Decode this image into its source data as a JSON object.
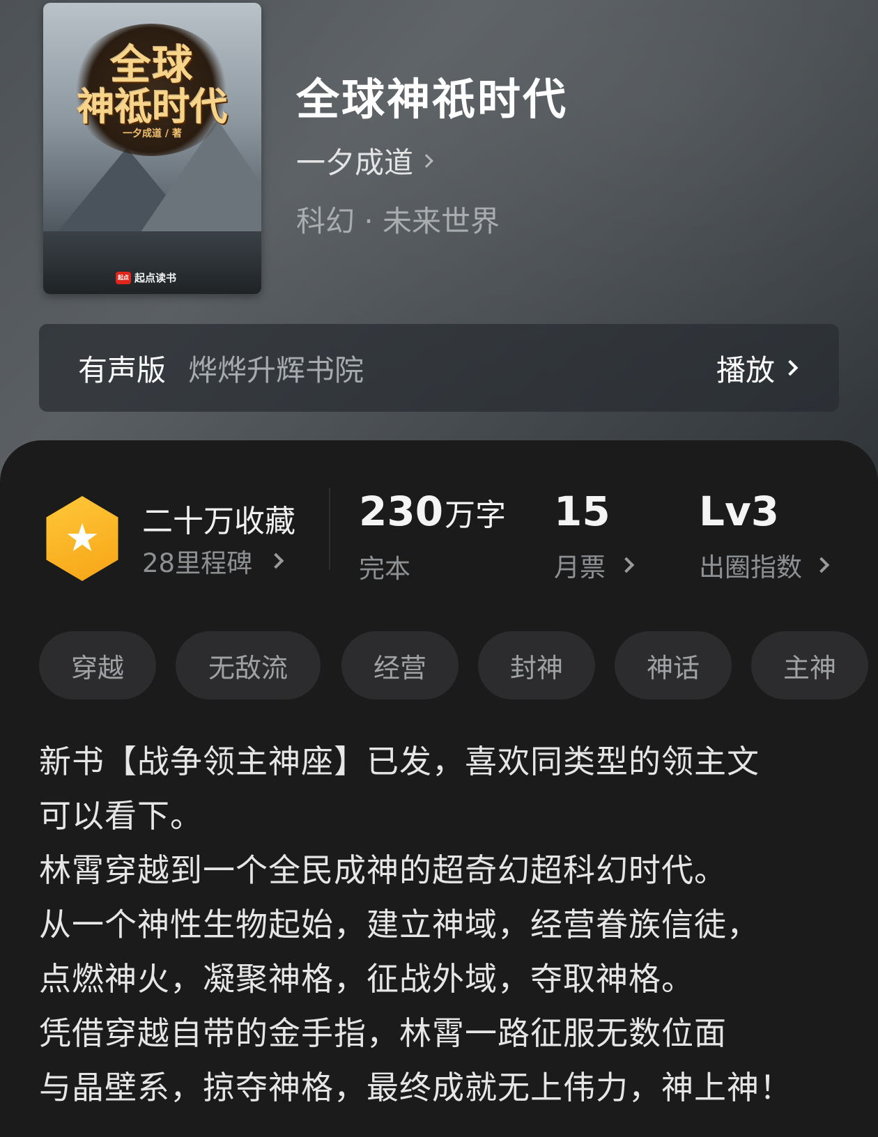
{
  "book": {
    "cover": {
      "title_line1": "全球",
      "title_line2": "神祗时代",
      "byline": "一夕成道 / 著",
      "publisher": "起点读书",
      "publisher_logo": "起点"
    },
    "title": "全球神祇时代",
    "author": "一夕成道",
    "genre": "科幻 · 未来世界"
  },
  "audio": {
    "label": "有声版",
    "narrator": "烨烨升辉书院",
    "play_label": "播放"
  },
  "stats": {
    "favorites": "二十万收藏",
    "milestones": "28里程碑",
    "words_number": "230",
    "words_unit": "万字",
    "status": "完本",
    "monthly_votes": "15",
    "monthly_votes_label": "月票",
    "level": "Lv3",
    "level_label": "出圈指数",
    "badge_color": "#F8B21F"
  },
  "tags": [
    "穿越",
    "无敌流",
    "经营",
    "封神",
    "神话",
    "主神"
  ],
  "description": [
    "新书【战争领主神座】已发，喜欢同类型的领主文",
    "可以看下。",
    "林霄穿越到一个全民成神的超奇幻超科幻时代。",
    "从一个神性生物起始，建立神域，经营眷族信徒，",
    "点燃神火，凝聚神格，征战外域，夺取神格。",
    "凭借穿越自带的金手指，林霄一路征服无数位面",
    "与晶壁系，掠夺神格，最终成就无上伟力，神上神！"
  ]
}
